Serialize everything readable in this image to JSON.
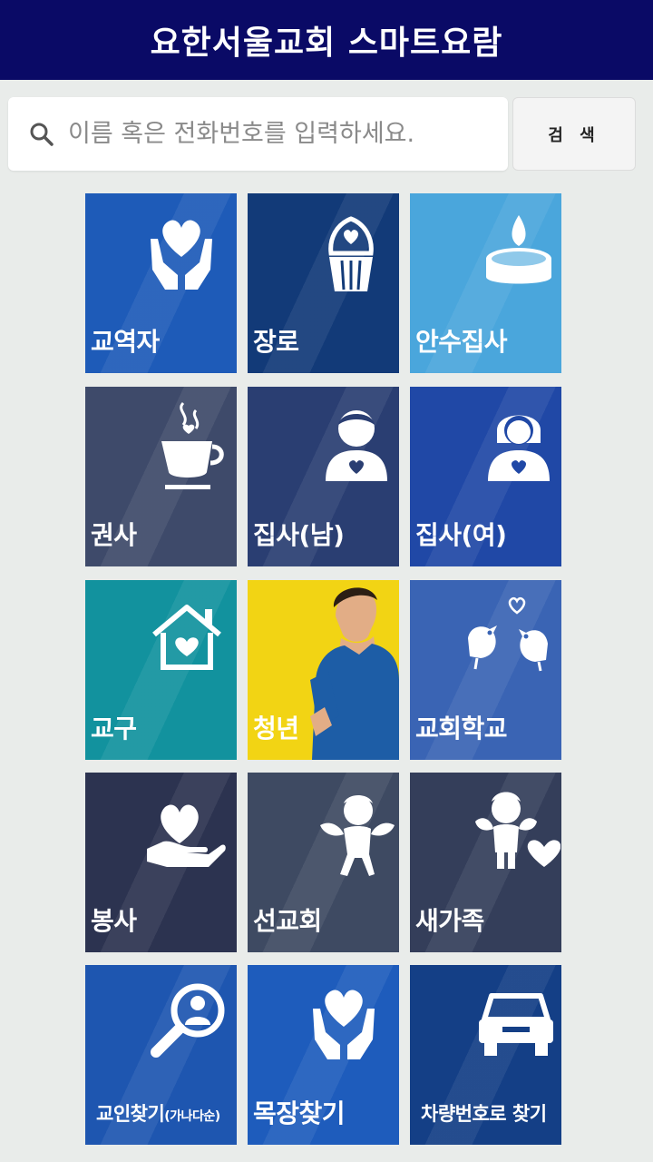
{
  "header": {
    "title": "요한서울교회 스마트요람"
  },
  "search": {
    "placeholder": "이름 혹은 전화번호를 입력하세요.",
    "button_label": "검 색"
  },
  "tiles": [
    {
      "label": "교역자",
      "icon": "hands-heart-icon",
      "color": "#1e5bb8"
    },
    {
      "label": "장로",
      "icon": "cupcake-heart-icon",
      "color": "#123a78"
    },
    {
      "label": "안수집사",
      "icon": "candle-icon",
      "color": "#4aa6dc"
    },
    {
      "label": "권사",
      "icon": "coffee-cup-icon",
      "color": "#3e4a6a"
    },
    {
      "label": "집사(남)",
      "icon": "man-heart-icon",
      "color": "#2a3e72"
    },
    {
      "label": "집사(여)",
      "icon": "woman-heart-icon",
      "color": "#2048a6"
    },
    {
      "label": "교구",
      "icon": "house-heart-icon",
      "color": "#12929e"
    },
    {
      "label": "청년",
      "icon": "young-man-photo",
      "color": "#f2d414"
    },
    {
      "label": "교회학교",
      "icon": "birds-heart-icon",
      "color": "#3a64b4"
    },
    {
      "label": "봉사",
      "icon": "hand-heart-icon",
      "color": "#2c3350"
    },
    {
      "label": "선교회",
      "icon": "cupid-icon",
      "color": "#3e4a62"
    },
    {
      "label": "새가족",
      "icon": "angel-heart-icon",
      "color": "#343e5a"
    },
    {
      "label_main": "교인찾기",
      "label_sub": "(가나다순)",
      "icon": "magnifier-person-icon",
      "color": "#1e56b0"
    },
    {
      "label": "목장찾기",
      "icon": "hands-heart-icon",
      "color": "#1e5cbc"
    },
    {
      "label": "차량번호로 찾기",
      "icon": "car-icon",
      "color": "#143f86"
    }
  ]
}
